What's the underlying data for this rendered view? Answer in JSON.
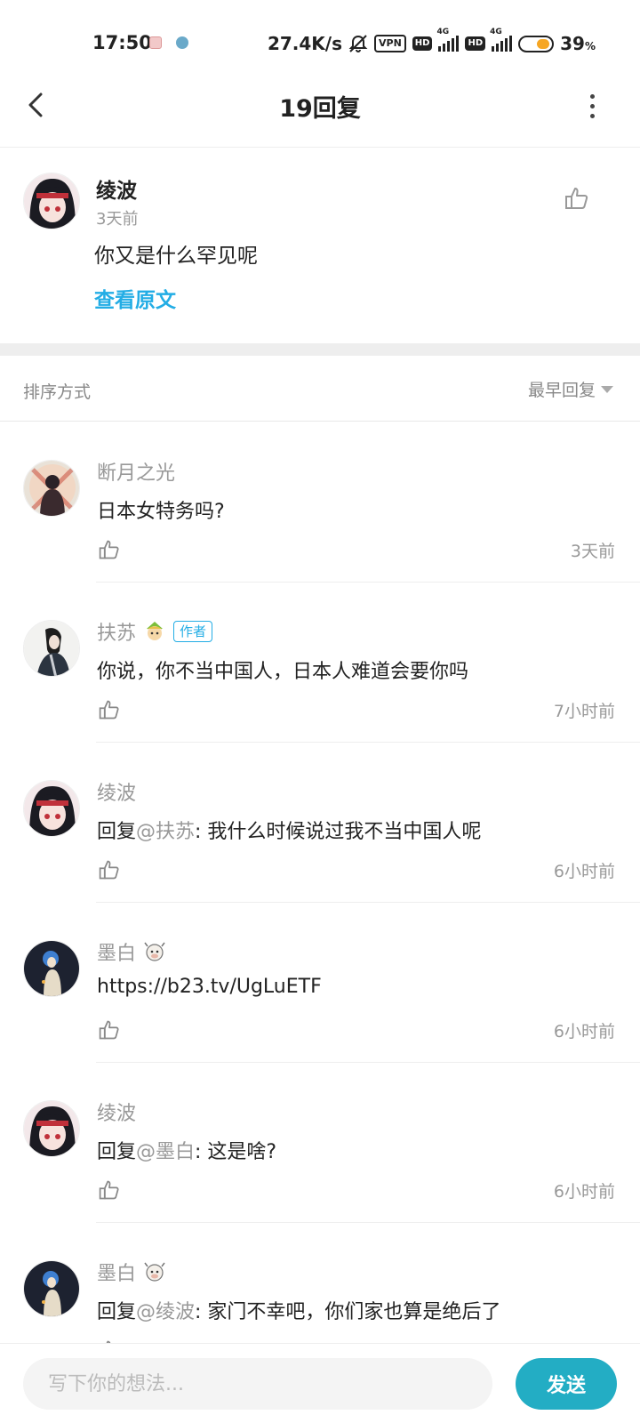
{
  "status_bar": {
    "time": "17:50",
    "net_speed": "27.4K/s",
    "vpn": "VPN",
    "hd": "HD",
    "network": "4G",
    "battery": "39",
    "battery_unit": "%"
  },
  "header": {
    "title": "19回复"
  },
  "original_comment": {
    "user": "绫波",
    "time": "3天前",
    "text": "你又是什么罕见呢",
    "view_original": "查看原文"
  },
  "sort": {
    "label": "排序方式",
    "selected": "最早回复"
  },
  "replies": [
    {
      "user": "断月之光",
      "text": "日本女特务吗?",
      "time": "3天前"
    },
    {
      "user": "扶苏",
      "author_tag": "作者",
      "text": "你说，你不当中国人，日本人难道会要你吗",
      "time": "7小时前"
    },
    {
      "user": "绫波",
      "prefix": "回复",
      "mention": "@扶苏",
      "text": ": 我什么时候说过我不当中国人呢",
      "time": "6小时前"
    },
    {
      "user": "墨白",
      "text": "https://b23.tv/UgLuETF",
      "time": "6小时前"
    },
    {
      "user": "绫波",
      "prefix": "回复",
      "mention": "@墨白",
      "text": ": 这是啥?",
      "time": "6小时前"
    },
    {
      "user": "墨白",
      "prefix": "回复",
      "mention": "@绫波",
      "text": ": 家门不幸吧，你们家也算是绝后了",
      "time": ""
    }
  ],
  "bottom": {
    "input_placeholder": "写下你的想法...",
    "send_label": "发送"
  },
  "colors": {
    "accent": "#23ade5",
    "send_button": "#23adc4",
    "battery": "#f6a623"
  }
}
